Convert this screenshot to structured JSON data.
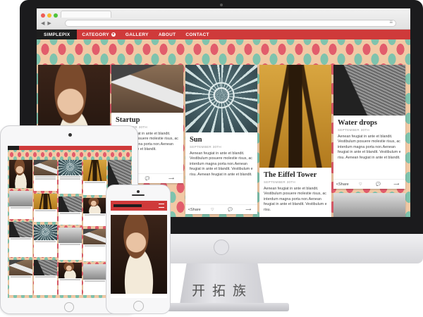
{
  "site": {
    "logo": "SIMPLEPIX",
    "nav": [
      {
        "label": "CATEGORY",
        "has_dropdown": true
      },
      {
        "label": "GALLERY",
        "has_dropdown": false
      },
      {
        "label": "ABOUT",
        "has_dropdown": false
      },
      {
        "label": "CONTACT",
        "has_dropdown": false
      }
    ]
  },
  "colors": {
    "accent": "#cf3a3a",
    "nav_dark": "#1e1e1e",
    "pattern_red": "#e25d6c",
    "pattern_teal": "#7fc3ad"
  },
  "cards": {
    "startup": {
      "title": "Startup",
      "date": "SEPTEMBER 30TH",
      "text": "Aenean feugiat in ante et blandit. Vestibulum posuere molestie risus, ac interdum magna porta non.Aenean feugiat in ante et blandit."
    },
    "sun": {
      "title": "Sun",
      "date": "SEPTEMBER 30TH",
      "text": "Aenean feugiat in ante et blandit. Vestibulum posuere molestie risus, ac interdum magna porta non.Aenean feugiat in ante et blandit. Vestibulum e risu. Aenean feugiat in ante et blandit.",
      "share": "Share"
    },
    "eiffel": {
      "title": "The Eiffel Tower",
      "date": "SEPTEMBER 30TH",
      "text": "Aenean feugiat in ante et blandit. Vestibulum posuere molestie risus, ac interdum magna porta non.Aenean feugiat in ante et blandit. Vestibulum e risu."
    },
    "water": {
      "title": "Water drops",
      "date": "SEPTEMBER 30TH",
      "text": "Aenean feugiat in ante et blandit. Vestibulum posuere molestie risus, ac interdum magna porta non.Aenean feugiat in ante et blandit. Vestibulum e risu. Aenean feugiat in ante et blandit.",
      "share": "Share"
    }
  },
  "icons": {
    "heart": "♡",
    "comment": "💬",
    "arrow": "⟶",
    "share": "<"
  },
  "watermark": "开拓族"
}
